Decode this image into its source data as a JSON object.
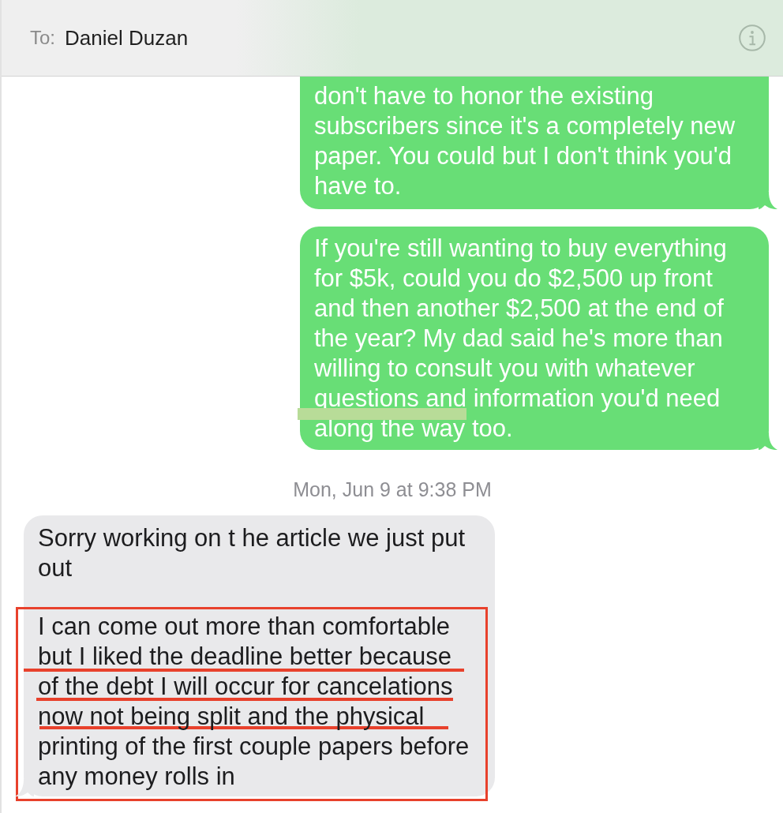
{
  "header": {
    "to_label": "To:",
    "recipient": "Daniel Duzan"
  },
  "messages": [
    {
      "kind": "sent",
      "highlighted": false,
      "paragraphs": [
        {
          "text": "don't have to honor the existing subscribers since it's a completely new paper. You could but I don't think you'd have to.",
          "boxed": false
        }
      ]
    },
    {
      "kind": "sent",
      "highlighted": true,
      "paragraphs": [
        {
          "text": "If you're still wanting to buy everything for $5k, could you do $2,500 up front and then another $2,500 at the end of the year? My dad said he's more than willing to consult you with whatever questions and information you'd need along the way too.",
          "boxed": false
        }
      ]
    },
    {
      "kind": "timestamp",
      "text": "Mon, Jun 9 at 9:38 PM"
    },
    {
      "kind": "received",
      "highlighted": false,
      "paragraphs": [
        {
          "text": "Sorry working on t he article we just put out",
          "boxed": false
        },
        {
          "text": "I can come out more than comfortable but I liked the deadline better because of the debt I will occur for cancelations now not being split and the physical printing of the first couple papers before any money rolls in",
          "boxed": true
        }
      ]
    }
  ]
}
